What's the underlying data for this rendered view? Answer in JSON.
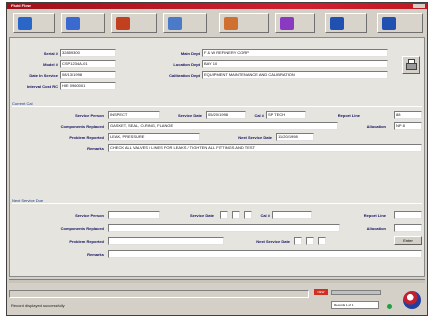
{
  "window": {
    "title": "Fluid Flow",
    "accent": "#c01820"
  },
  "toolbar": [
    {
      "icon": "grid-icon",
      "color": "#2a66c8"
    },
    {
      "icon": "person-icon",
      "color": "#3a6ad0"
    },
    {
      "icon": "form-icon",
      "color": "#c04020"
    },
    {
      "icon": "chart-icon",
      "color": "#4a7ac8"
    },
    {
      "icon": "people-icon",
      "color": "#d07030"
    },
    {
      "icon": "tasks-icon",
      "color": "#8a3ac0"
    },
    {
      "icon": "help-icon",
      "color": "#2050b0"
    },
    {
      "icon": "exit-icon",
      "color": "#2050b0"
    }
  ],
  "header_fields": {
    "left": [
      {
        "label": "Serial #",
        "value": "32859300"
      },
      {
        "label": "Model #",
        "value": "CSP1234A-01"
      },
      {
        "label": "Date In Service",
        "value": "08/13/1998"
      },
      {
        "label": "Interval Cost RC",
        "value": "HIE 0960001"
      }
    ],
    "right": [
      {
        "label": "Main Dept",
        "value": "F & W REFINERY CORP"
      },
      {
        "label": "Location Dept",
        "value": "BAY 10"
      },
      {
        "label": "Calibration Dept",
        "value": "EQUIPMENT MAINTENANCE AND CALIBRATION"
      }
    ]
  },
  "current": {
    "section_label": "Current Cal",
    "service_person_label": "Service Person",
    "service_person": "INSPECT",
    "service_date_label": "Service Date",
    "service_date": "05/20/1998",
    "cal_label": "Cal #",
    "cal_value": "SP TECH",
    "report_label": "Report Line",
    "report_value": "88",
    "comp_label": "Components Replaced",
    "comp_value": "GASKET, SEAL, O-RING, FLANGE",
    "allocation_label": "Allocation",
    "allocation_value": "NP 8",
    "problem_label": "Problem Reported",
    "problem_value": "LEAK, PRESSURE",
    "next_date_label": "Next Service Date",
    "next_date_value": "11/20/1998",
    "remarks_label": "Remarks",
    "remarks_value": "CHECK ALL VALVES / LINES FOR LEAKS / TIGHTEN ALL FITTINGS AND TEST"
  },
  "next": {
    "section_label": "Next Service Due",
    "service_person_label": "Service Person",
    "service_date_label": "Service Date",
    "cal_label": "Cal #",
    "report_label": "Report Line",
    "comp_label": "Components Replaced",
    "allocation_label": "Allocation",
    "problem_label": "Problem Reported",
    "next_date_label": "Next Service Date",
    "remarks_label": "Remarks",
    "go_label": "Enter"
  },
  "status": {
    "message": "Record displayed successfully",
    "badge": "NEW",
    "count": "Records 1 of 1"
  }
}
